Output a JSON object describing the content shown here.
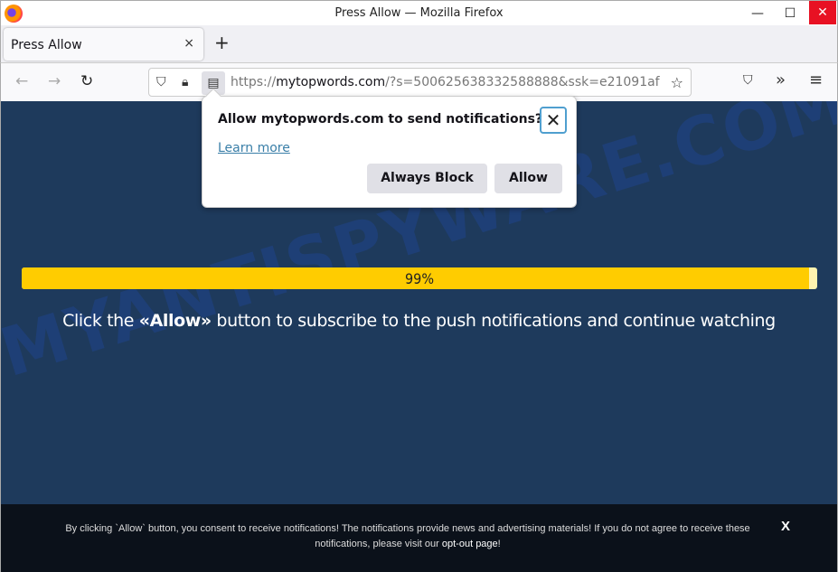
{
  "window": {
    "title": "Press Allow — Mozilla Firefox",
    "minimize_icon": "—",
    "maximize_icon": "☐",
    "close_icon": "✕"
  },
  "tabs": [
    {
      "label": "Press Allow",
      "close_icon": "×"
    }
  ],
  "new_tab_icon": "+",
  "nav": {
    "back_icon": "←",
    "forward_icon": "→",
    "reload_icon": "↻",
    "shield_icon": "⛉",
    "lock_icon": "🔒︎",
    "permission_icon": "▤",
    "url_scheme": "https://",
    "url_host": "mytopwords.com",
    "url_rest": "/?s=500625638332588888&ssk=e21091af",
    "star_icon": "☆",
    "pocket_icon": "⛉",
    "overflow_icon": "»",
    "menu_icon": "≡"
  },
  "popup": {
    "title": "Allow mytopwords.com to send notifications?",
    "close_icon": "✕",
    "learn_more": "Learn more",
    "block_button": "Always Block",
    "allow_button": "Allow"
  },
  "page": {
    "watermark": "MYANTISPYWARE.COM",
    "progress_percent": 99,
    "progress_label": "99%",
    "headline_pre": "Click the ",
    "headline_bold": "«Allow»",
    "headline_post": " button to subscribe to the push notifications and continue watching"
  },
  "footer": {
    "text": "By clicking `Allow` button, you consent to receive notifications! The notifications provide news and advertising materials! If you do not agree to receive these notifications, please visit our ",
    "link": "opt-out page",
    "suffix": "!",
    "close_icon": "X"
  }
}
